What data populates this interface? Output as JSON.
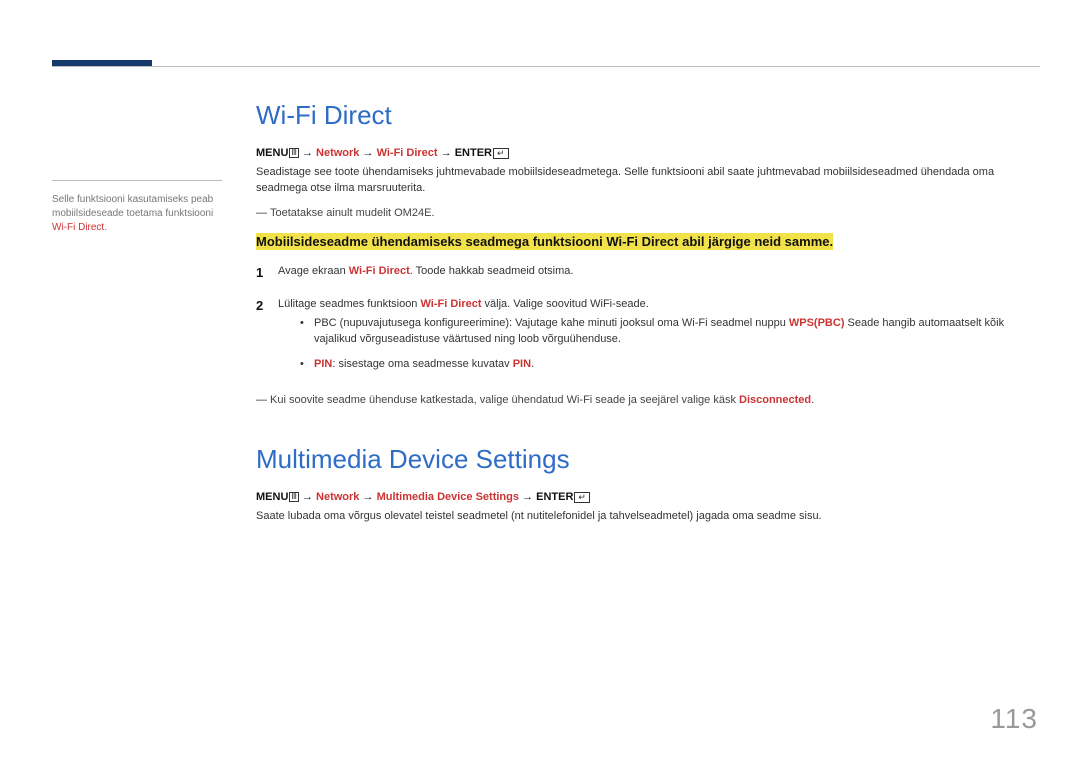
{
  "page_number": "113",
  "side_note": {
    "text_before": "Selle funktsiooni kasutamiseks peab mobiilsideseade toetama funktsiooni ",
    "red": "Wi-Fi Direct",
    "text_after": "."
  },
  "section1": {
    "title": "Wi-Fi Direct",
    "nav": {
      "menu": "MENU",
      "step1": "Network",
      "step2": "Wi-Fi Direct",
      "enter": "ENTER",
      "arrow": "→"
    },
    "p1": "Seadistage see toote ühendamiseks juhtmevabade mobiilsideseadmetega. Selle funktsiooni abil saate juhtmevabad mobiilsideseadmed ühendada oma seadmega otse ilma marsruuterita.",
    "note1": "Toetatakse ainult mudelit OM24E.",
    "highlight": "Mobiilsideseadme ühendamiseks seadmega funktsiooni Wi-Fi Direct abil järgige neid samme.",
    "steps": [
      {
        "num": "1",
        "pre": "Avage ekraan ",
        "red": "Wi-Fi Direct",
        "post": ". Toode hakkab seadmeid otsima."
      },
      {
        "num": "2",
        "pre": "Lülitage seadmes funktsioon ",
        "red": "Wi-Fi Direct",
        "post": " välja. Valige soovitud WiFi-seade."
      }
    ],
    "bullets": [
      {
        "pre": "PBC (nupuvajutusega konfigureerimine): Vajutage kahe minuti jooksul oma Wi-Fi seadmel nuppu ",
        "red": "WPS(PBC)",
        "post": " Seade hangib automaatselt kõik vajalikud võrguseadistuse väärtused ning loob võrguühenduse."
      },
      {
        "preRed": "PIN",
        "mid": ": sisestage oma seadmesse kuvatav ",
        "red": "PIN",
        "post": "."
      }
    ],
    "footnote": {
      "pre": "Kui soovite seadme ühenduse katkestada, valige ühendatud Wi-Fi seade ja seejärel valige käsk ",
      "red": "Disconnected",
      "post": "."
    }
  },
  "section2": {
    "title": "Multimedia Device Settings",
    "nav": {
      "menu": "MENU",
      "step1": "Network",
      "step2": "Multimedia Device Settings",
      "enter": "ENTER",
      "arrow": "→"
    },
    "p1": "Saate lubada oma võrgus olevatel teistel seadmetel (nt nutitelefonidel ja tahvelseadmetel) jagada oma seadme sisu."
  }
}
